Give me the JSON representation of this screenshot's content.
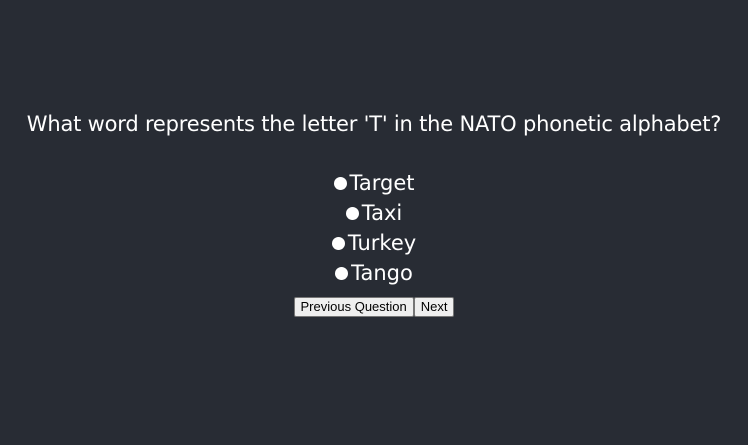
{
  "quiz": {
    "question": "What word represents the letter 'T' in the NATO phonetic alphabet?",
    "options": [
      {
        "label": "Target",
        "selected": false
      },
      {
        "label": "Taxi",
        "selected": false
      },
      {
        "label": "Turkey",
        "selected": false
      },
      {
        "label": "Tango",
        "selected": false
      }
    ],
    "previous_label": "Previous Question",
    "next_label": "Next"
  },
  "colors": {
    "background": "#282c34",
    "text": "#ffffff",
    "button_background": "#efefef"
  }
}
